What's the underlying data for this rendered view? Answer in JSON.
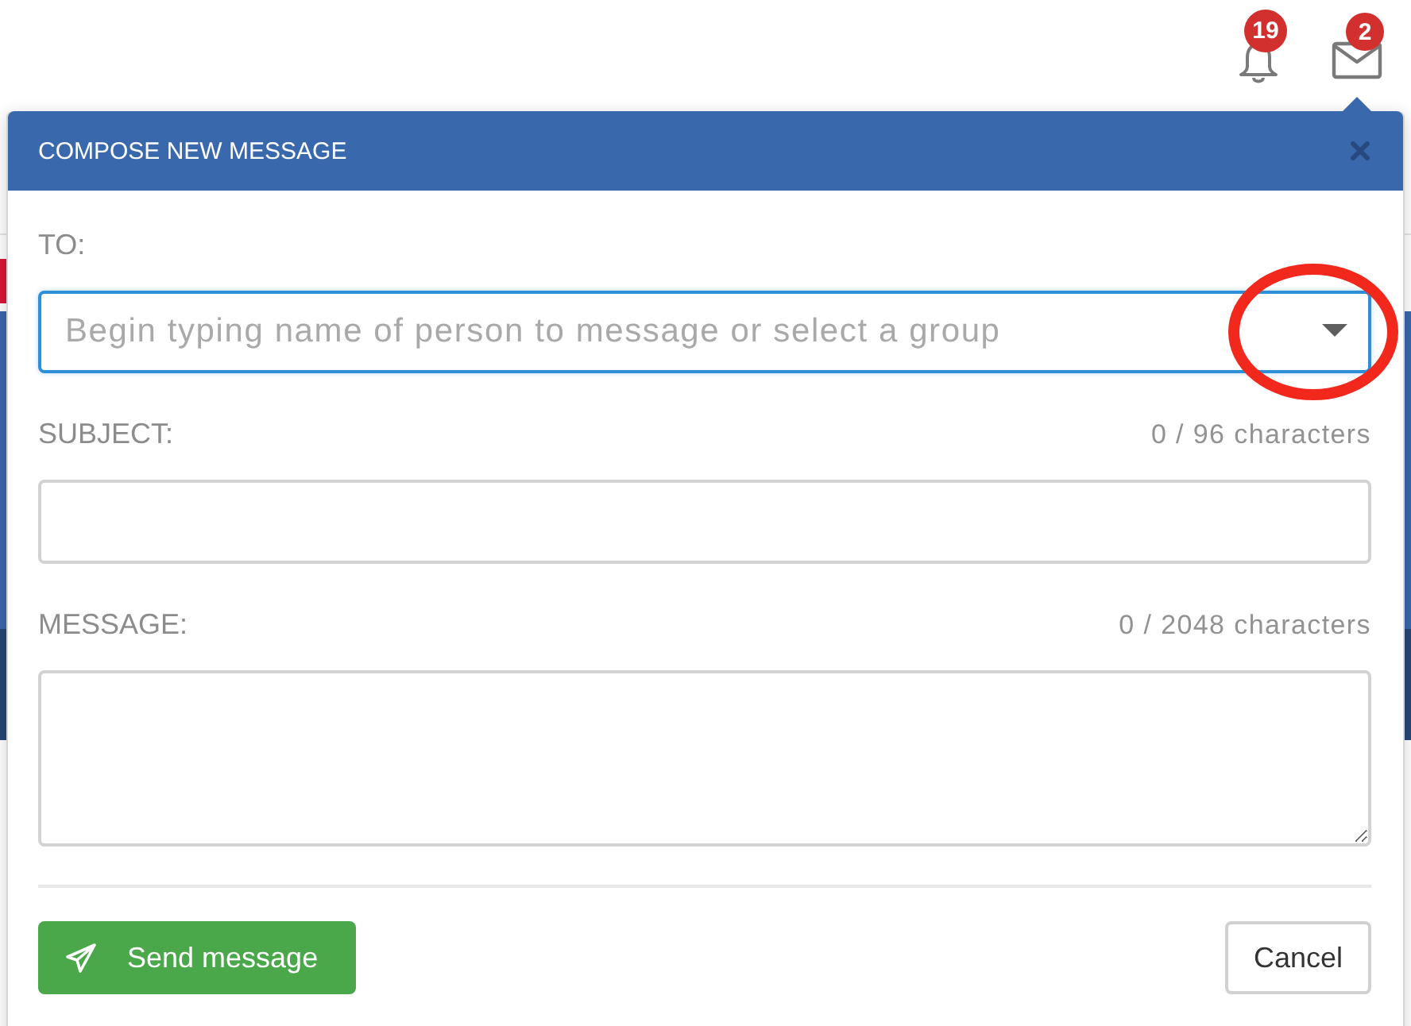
{
  "header": {
    "notifications": {
      "count": "19"
    },
    "messages": {
      "count": "2"
    }
  },
  "dialog": {
    "title": "COMPOSE NEW MESSAGE",
    "fields": [
      {
        "kind": "select",
        "label": "TO:",
        "placeholder": "Begin typing name of person to message or select a group",
        "focused": true,
        "highlighted": true
      },
      {
        "kind": "text",
        "label": "SUBJECT:",
        "counter": "0 / 96 characters",
        "focused": false,
        "highlighted": false
      },
      {
        "kind": "textarea",
        "label": "MESSAGE:",
        "counter": "0 / 2048 characters",
        "focused": false,
        "highlighted": false
      }
    ],
    "buttons": [
      {
        "kind": "primary",
        "label": "Send message"
      },
      {
        "kind": "secondary",
        "label": "Cancel"
      }
    ]
  }
}
